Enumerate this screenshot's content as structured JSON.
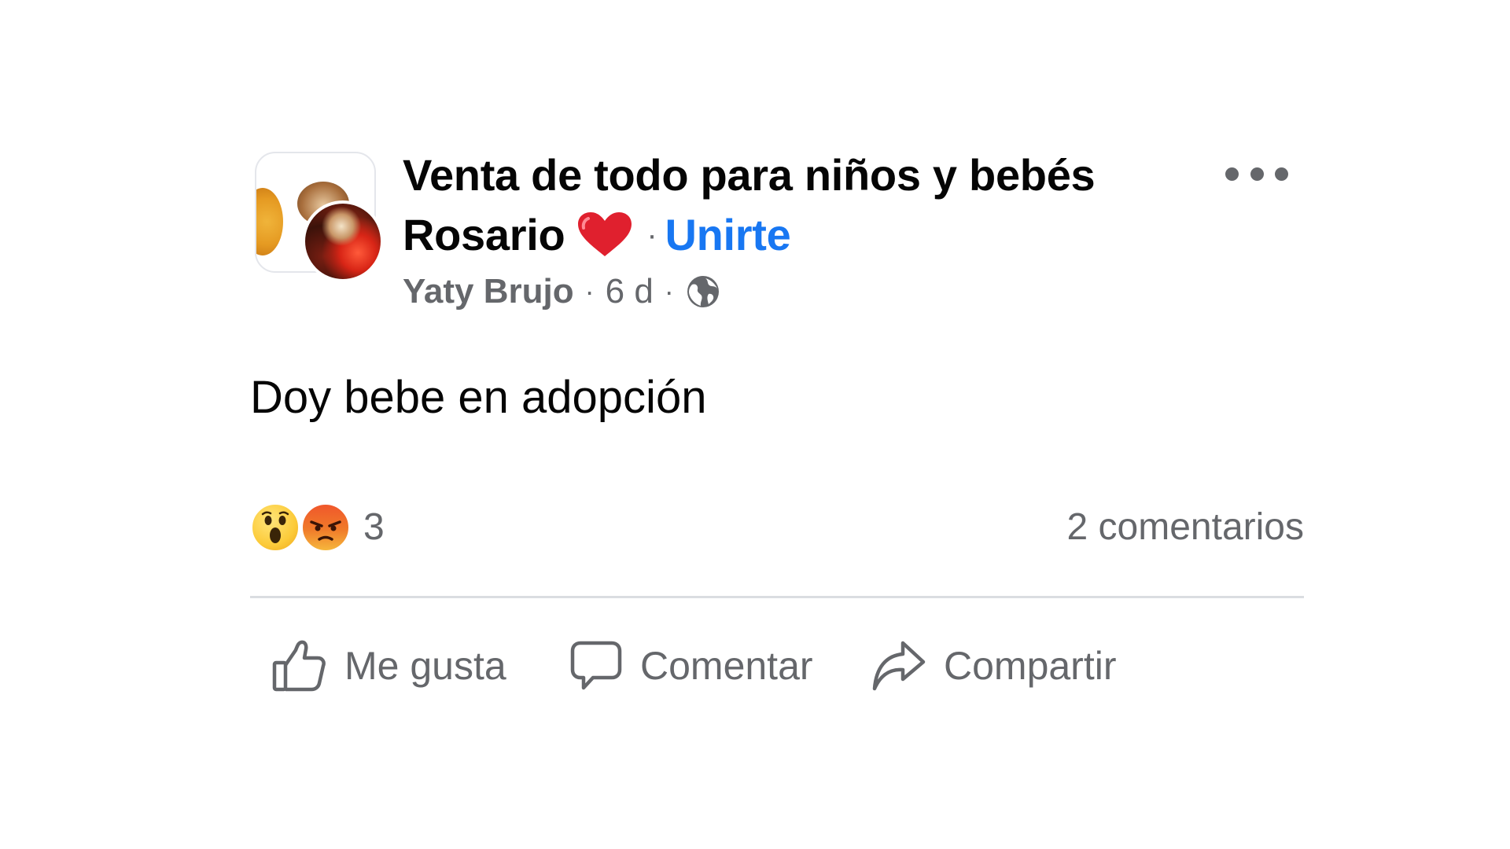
{
  "post": {
    "group_name": "Venta de todo para niños y bebés Rosario",
    "heart_icon": "red-heart-icon",
    "separator": "·",
    "join_label": "Unirte",
    "author": "Yaty Brujo",
    "meta_separator": "·",
    "time_ago": "6 d",
    "privacy_icon": "globe-icon",
    "more_icon": "more-options-icon",
    "text": "Doy bebe en adopción"
  },
  "reactions": {
    "icons": [
      "wow-reaction-icon",
      "angry-reaction-icon"
    ],
    "count": "3",
    "comments_label": "2 comentarios"
  },
  "actions": {
    "like_label": "Me gusta",
    "comment_label": "Comentar",
    "share_label": "Compartir"
  },
  "colors": {
    "link_blue": "#1877f2",
    "secondary_text": "#65676b",
    "primary_text": "#050505",
    "divider": "#dadde1"
  }
}
